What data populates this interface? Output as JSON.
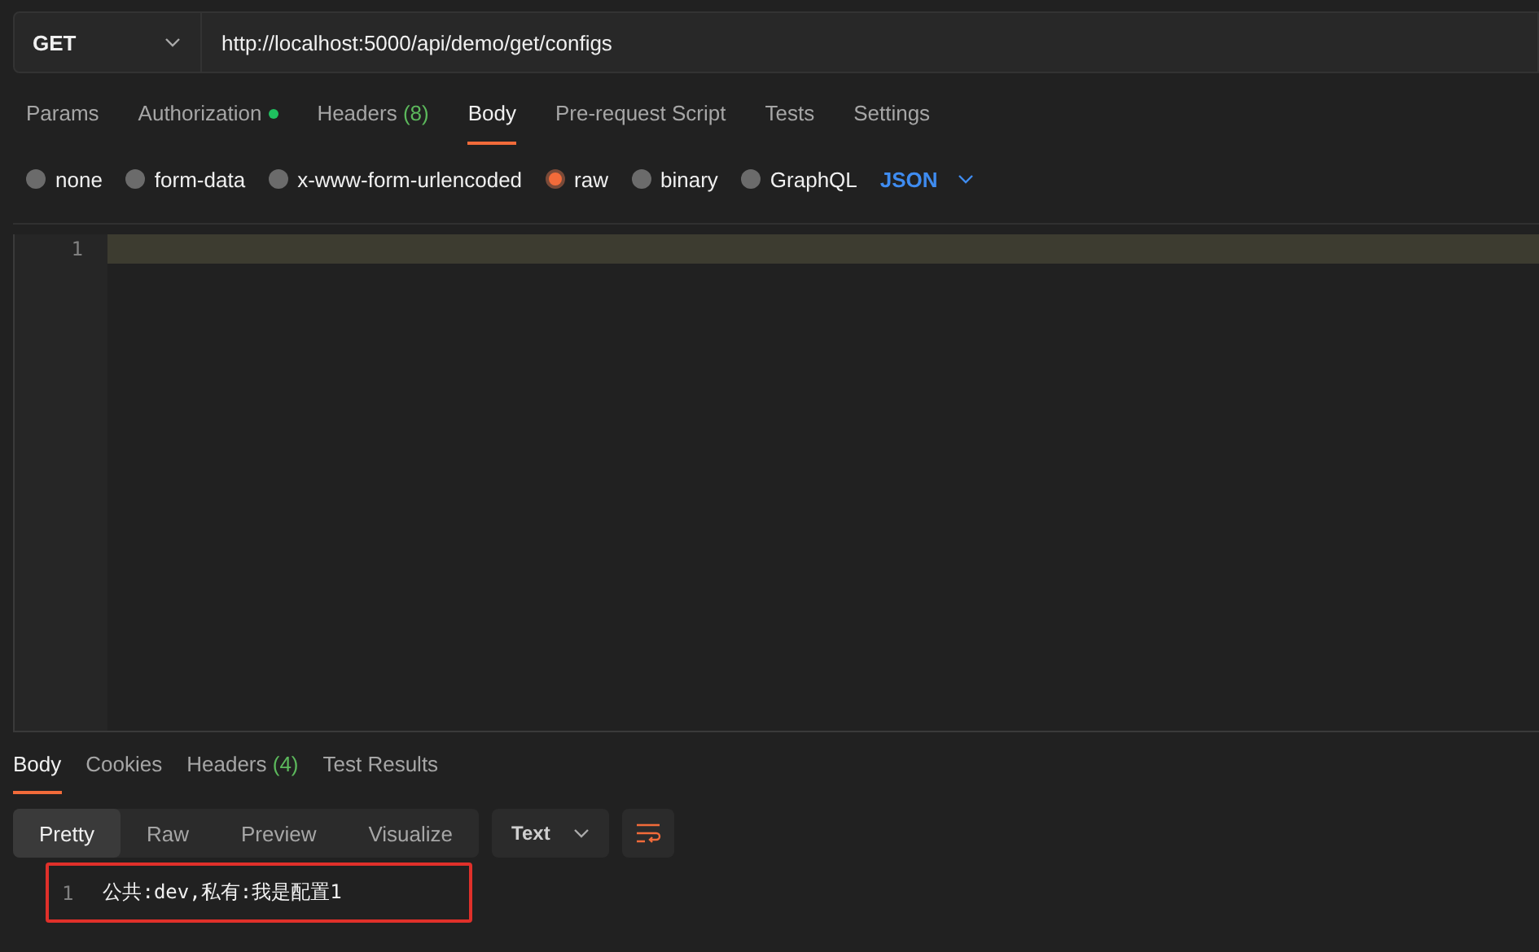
{
  "request": {
    "method": "GET",
    "url": "http://localhost:5000/api/demo/get/configs"
  },
  "request_tabs": [
    {
      "label": "Params",
      "selected": false,
      "dot": false
    },
    {
      "label": "Authorization",
      "selected": false,
      "dot": true
    },
    {
      "label": "Headers",
      "count": "(8)",
      "selected": false,
      "dot": false
    },
    {
      "label": "Body",
      "selected": true,
      "dot": false
    },
    {
      "label": "Pre-request Script",
      "selected": false,
      "dot": false
    },
    {
      "label": "Tests",
      "selected": false,
      "dot": false
    },
    {
      "label": "Settings",
      "selected": false,
      "dot": false
    }
  ],
  "body_types": [
    {
      "label": "none",
      "selected": false
    },
    {
      "label": "form-data",
      "selected": false
    },
    {
      "label": "x-www-form-urlencoded",
      "selected": false
    },
    {
      "label": "raw",
      "selected": true
    },
    {
      "label": "binary",
      "selected": false
    },
    {
      "label": "GraphQL",
      "selected": false
    }
  ],
  "body_format": "JSON",
  "editor": {
    "line_numbers": [
      "1"
    ]
  },
  "response_tabs": [
    {
      "label": "Body",
      "selected": true
    },
    {
      "label": "Cookies",
      "selected": false
    },
    {
      "label": "Headers",
      "count": "(4)",
      "selected": false
    },
    {
      "label": "Test Results",
      "selected": false
    }
  ],
  "response_views": [
    {
      "label": "Pretty",
      "selected": true
    },
    {
      "label": "Raw",
      "selected": false
    },
    {
      "label": "Preview",
      "selected": false
    },
    {
      "label": "Visualize",
      "selected": false
    }
  ],
  "response_format": "Text",
  "response_lines": [
    {
      "number": "1",
      "text": "公共:dev,私有:我是配置1"
    }
  ],
  "response_highlighted": true
}
